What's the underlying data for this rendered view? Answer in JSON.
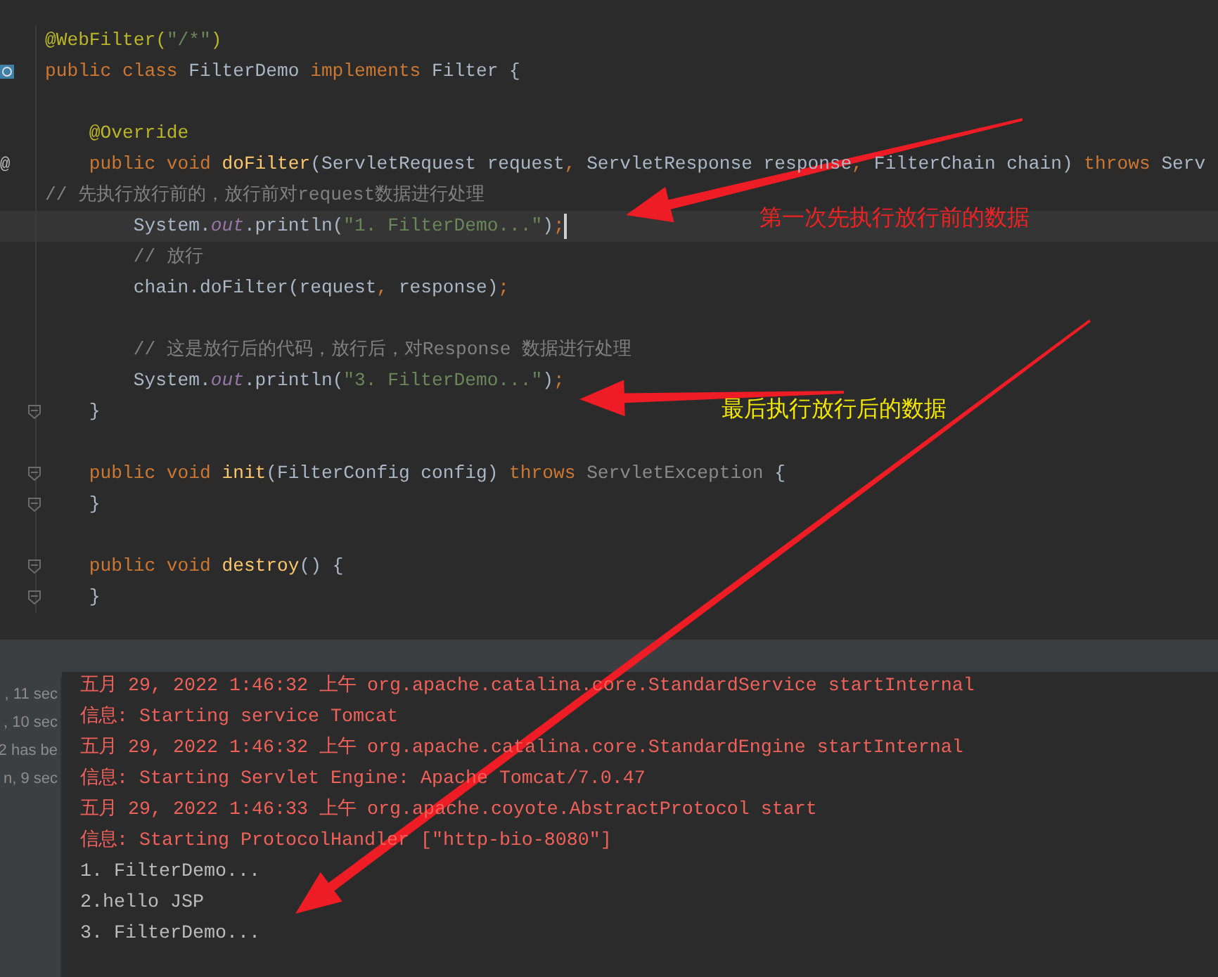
{
  "editor": {
    "lines": [
      {
        "current": false,
        "tokens": [
          {
            "t": "@WebFilter(",
            "kind": "ann"
          },
          {
            "t": "\"/*\"",
            "kind": "str"
          },
          {
            "t": ")",
            "kind": "ann"
          }
        ]
      },
      {
        "current": false,
        "fold": false,
        "tokens": [
          {
            "t": "public class ",
            "kind": "kw"
          },
          {
            "t": "FilterDemo ",
            "kind": "plain"
          },
          {
            "t": "implements ",
            "kind": "kw"
          },
          {
            "t": "Filter {",
            "kind": "plain"
          }
        ]
      },
      {
        "current": false
      },
      {
        "current": false,
        "tokens": [
          {
            "t": "    @Override",
            "kind": "ann"
          }
        ]
      },
      {
        "current": false,
        "fold": false,
        "gutter_mark": "@",
        "tokens": [
          {
            "t": "    public void ",
            "kind": "kw"
          },
          {
            "t": "doFilter",
            "kind": "decl"
          },
          {
            "t": "(ServletRequest request",
            "kind": "plain"
          },
          {
            "t": ", ",
            "kind": "kw"
          },
          {
            "t": "ServletResponse response",
            "kind": "plain"
          },
          {
            "t": ", ",
            "kind": "kw"
          },
          {
            "t": "FilterChain chain) ",
            "kind": "plain"
          },
          {
            "t": "throws ",
            "kind": "kw"
          },
          {
            "t": "Serv",
            "kind": "plain"
          }
        ]
      },
      {
        "current": false,
        "tokens": [
          {
            "t": "// 先执行放行前的，放行前对request数据进行处理",
            "kind": "comment"
          }
        ]
      },
      {
        "current": true,
        "tokens": [
          {
            "t": "        System.",
            "kind": "plain"
          },
          {
            "t": "out",
            "kind": "field"
          },
          {
            "t": ".println(",
            "kind": "plain"
          },
          {
            "t": "\"1. FilterDemo...\"",
            "kind": "str"
          },
          {
            "t": ")",
            "kind": "plain"
          },
          {
            "t": ";",
            "kind": "kw"
          }
        ]
      },
      {
        "current": false,
        "tokens": [
          {
            "t": "        // 放行",
            "kind": "comment"
          }
        ]
      },
      {
        "current": false,
        "tokens": [
          {
            "t": "        chain.doFilter(request",
            "kind": "plain"
          },
          {
            "t": ", ",
            "kind": "kw"
          },
          {
            "t": "response)",
            "kind": "plain"
          },
          {
            "t": ";",
            "kind": "kw"
          }
        ]
      },
      {
        "current": false
      },
      {
        "current": false,
        "tokens": [
          {
            "t": "        // 这是放行后的代码，放行后，对Response 数据进行处理",
            "kind": "comment"
          }
        ]
      },
      {
        "current": false,
        "tokens": [
          {
            "t": "        System.",
            "kind": "plain"
          },
          {
            "t": "out",
            "kind": "field"
          },
          {
            "t": ".println(",
            "kind": "plain"
          },
          {
            "t": "\"3. FilterDemo...\"",
            "kind": "str"
          },
          {
            "t": ")",
            "kind": "plain"
          },
          {
            "t": ";",
            "kind": "kw"
          }
        ]
      },
      {
        "current": false,
        "fold": true,
        "tokens": [
          {
            "t": "    }",
            "kind": "plain"
          }
        ]
      },
      {
        "current": false
      },
      {
        "current": false,
        "fold": true,
        "tokens": [
          {
            "t": "    public void ",
            "kind": "kw"
          },
          {
            "t": "init",
            "kind": "decl"
          },
          {
            "t": "(FilterConfig config) ",
            "kind": "plain"
          },
          {
            "t": "throws ",
            "kind": "kw"
          },
          {
            "t": "ServletException ",
            "kind": "dim"
          },
          {
            "t": "{",
            "kind": "plain"
          }
        ]
      },
      {
        "current": false,
        "fold": true,
        "tokens": [
          {
            "t": "    }",
            "kind": "plain"
          }
        ]
      },
      {
        "current": false
      },
      {
        "current": false,
        "fold": true,
        "tokens": [
          {
            "t": "    public void ",
            "kind": "kw"
          },
          {
            "t": "destroy",
            "kind": "decl"
          },
          {
            "t": "() {",
            "kind": "plain"
          }
        ]
      },
      {
        "current": false,
        "fold": true,
        "tokens": [
          {
            "t": "    }",
            "kind": "plain"
          }
        ]
      }
    ]
  },
  "annotations": [
    {
      "text": "第一次先执行放行前的数据",
      "color": "#ee2222"
    },
    {
      "text": "最后执行放行后的数据",
      "color": "#f2e600"
    }
  ],
  "run_panel": {
    "history": [
      ", 11 sec",
      ", 10 sec",
      "2 has be",
      "n, 9 sec"
    ],
    "console": [
      {
        "kind": "log",
        "text": "五月 29, 2022 1:46:32 上午 org.apache.catalina.core.StandardService startInternal"
      },
      {
        "kind": "log",
        "text": "信息: Starting service Tomcat"
      },
      {
        "kind": "log",
        "text": "五月 29, 2022 1:46:32 上午 org.apache.catalina.core.StandardEngine startInternal"
      },
      {
        "kind": "log",
        "text": "信息: Starting Servlet Engine: Apache Tomcat/7.0.47"
      },
      {
        "kind": "log",
        "text": "五月 29, 2022 1:46:33 上午 org.apache.coyote.AbstractProtocol start"
      },
      {
        "kind": "log",
        "text": "信息: Starting ProtocolHandler [\"http-bio-8080\"]"
      },
      {
        "kind": "out",
        "text": "1. FilterDemo..."
      },
      {
        "kind": "out",
        "text": "2.hello JSP"
      },
      {
        "kind": "out",
        "text": "3. FilterDemo..."
      }
    ]
  }
}
